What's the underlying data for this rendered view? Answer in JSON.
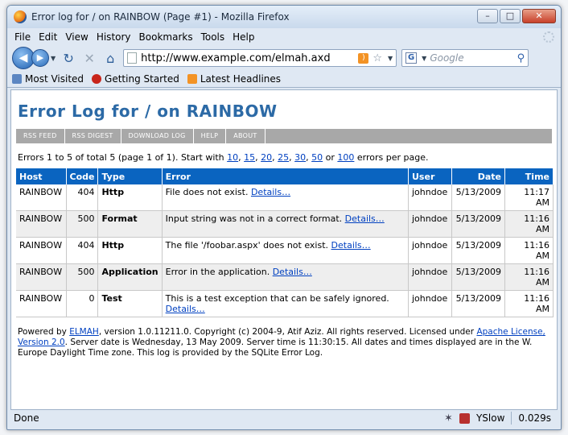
{
  "window": {
    "title": "Error log for / on RAINBOW (Page #1) - Mozilla Firefox",
    "controls": {
      "minimize": "–",
      "maximize": "□",
      "close": "✕"
    }
  },
  "menu": [
    "File",
    "Edit",
    "View",
    "History",
    "Bookmarks",
    "Tools",
    "Help"
  ],
  "nav": {
    "url": "http://www.example.com/elmah.axd",
    "search_placeholder": "Google"
  },
  "bookmarks": [
    "Most Visited",
    "Getting Started",
    "Latest Headlines"
  ],
  "page": {
    "title": "Error Log for / on RAINBOW",
    "speedbar": [
      "RSS FEED",
      "RSS DIGEST",
      "DOWNLOAD LOG",
      "HELP",
      "ABOUT"
    ],
    "summary": {
      "prefix": "Errors 1 to 5 of total 5 (page 1 of 1). Start with ",
      "page_sizes": [
        "10",
        "15",
        "20",
        "25",
        "30",
        "50",
        "100"
      ],
      "suffix": " errors per page.",
      "separator": ", ",
      "or": " or "
    },
    "table": {
      "headers": [
        "Host",
        "Code",
        "Type",
        "Error",
        "User",
        "Date",
        "Time"
      ],
      "details_label": "Details…",
      "rows": [
        {
          "host": "RAINBOW",
          "code": "404",
          "type": "Http",
          "error": "File does not exist.",
          "user": "johndoe",
          "date": "5/13/2009",
          "time": "11:17 AM"
        },
        {
          "host": "RAINBOW",
          "code": "500",
          "type": "Format",
          "error": "Input string was not in a correct format.",
          "user": "johndoe",
          "date": "5/13/2009",
          "time": "11:16 AM"
        },
        {
          "host": "RAINBOW",
          "code": "404",
          "type": "Http",
          "error": "The file '/foobar.aspx' does not exist.",
          "user": "johndoe",
          "date": "5/13/2009",
          "time": "11:16 AM"
        },
        {
          "host": "RAINBOW",
          "code": "500",
          "type": "Application",
          "error": "Error in the application.",
          "user": "johndoe",
          "date": "5/13/2009",
          "time": "11:16 AM"
        },
        {
          "host": "RAINBOW",
          "code": "0",
          "type": "Test",
          "error": "This is a test exception that can be safely ignored.",
          "user": "johndoe",
          "date": "5/13/2009",
          "time": "11:16 AM"
        }
      ]
    },
    "footer": {
      "part1": "Powered by ",
      "elmah_link": "ELMAH",
      "part2": ", version 1.0.11211.0. Copyright (c) 2004-9, Atif Aziz. All rights reserved. Licensed under ",
      "license_link": "Apache License, Version 2.0",
      "part3": ". Server date is Wednesday, 13 May 2009. Server time is 11:30:15. All dates and times displayed are in the W. Europe Daylight Time zone. This log is provided by the SQLite Error Log."
    }
  },
  "status": {
    "text": "Done",
    "yslow": "YSlow",
    "time": "0.029s"
  }
}
